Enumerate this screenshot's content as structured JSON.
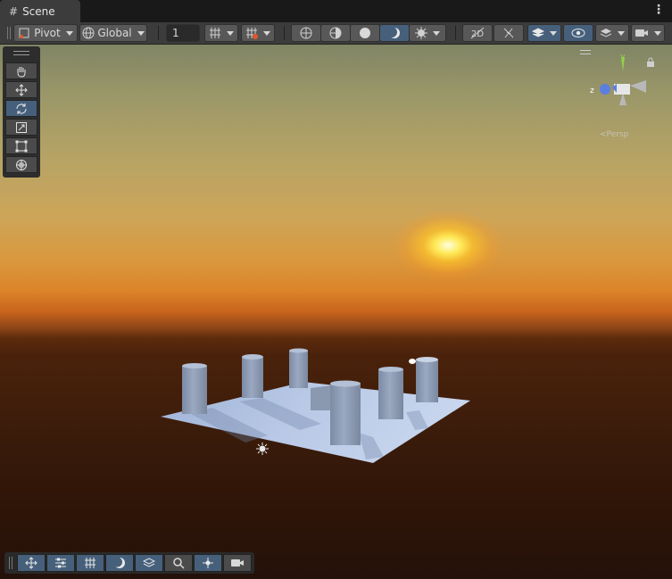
{
  "window": {
    "tab_label": "Scene"
  },
  "toolbar": {
    "pivot_label": "Pivot",
    "global_label": "Global",
    "grid_size_value": "1"
  },
  "colors": {
    "accent": "#46607c",
    "toolbar_bg": "#3c3c3c",
    "panel_bg": "#191919"
  },
  "tools": [
    {
      "name": "hand-tool",
      "icon": "hand-icon",
      "active": false
    },
    {
      "name": "move-tool",
      "icon": "move-arrows-icon",
      "active": false
    },
    {
      "name": "rotate-tool",
      "icon": "rotate-icon",
      "active": true
    },
    {
      "name": "scale-tool",
      "icon": "scale-icon",
      "active": false
    },
    {
      "name": "rect-tool",
      "icon": "rect-transform-icon",
      "active": false
    },
    {
      "name": "transform-tool",
      "icon": "transform-icon",
      "active": false
    }
  ],
  "gizmo": {
    "x_label": "y",
    "z_label": "z",
    "projection_label": "Persp"
  },
  "bottom_overlays": [
    "move-overlay",
    "settings-overlay",
    "grid-overlay",
    "lighting-overlay",
    "layers-overlay",
    "search-overlay",
    "navigation-overlay",
    "camera-overlay"
  ]
}
